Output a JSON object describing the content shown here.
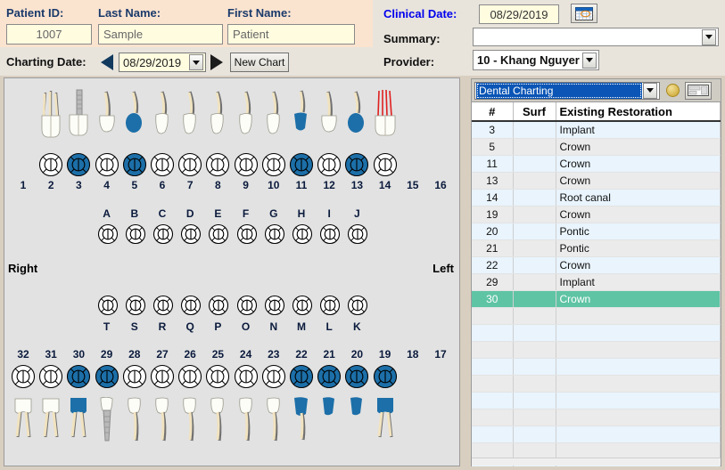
{
  "patient": {
    "id_label": "Patient ID:",
    "id_value": "1007",
    "last_label": "Last Name:",
    "last_value": "Sample",
    "first_label": "First Name:",
    "first_value": "Patient"
  },
  "charting": {
    "label": "Charting Date:",
    "date_value": "08/29/2019",
    "prev_icon": "left-triangle-icon",
    "next_icon": "right-triangle-icon",
    "new_chart_label": "New Chart"
  },
  "clinical": {
    "date_label": "Clinical Date:",
    "date_value": "08/29/2019",
    "calendar_icon": "calendar-icon",
    "summary_label": "Summary:",
    "summary_value": "",
    "provider_label": "Provider:",
    "provider_value": "10 - Khang Nguyer"
  },
  "grid": {
    "mode_value": "Dental Charting",
    "gold_icon": "gold-circle-icon",
    "window_icon": "window-layout-icon",
    "columns": [
      "#",
      "Surf",
      "Existing Restoration"
    ],
    "rows": [
      {
        "num": "3",
        "surf": "",
        "restoration": "Implant"
      },
      {
        "num": "5",
        "surf": "",
        "restoration": "Crown"
      },
      {
        "num": "11",
        "surf": "",
        "restoration": "Crown"
      },
      {
        "num": "13",
        "surf": "",
        "restoration": "Crown"
      },
      {
        "num": "14",
        "surf": "",
        "restoration": "Root canal"
      },
      {
        "num": "19",
        "surf": "",
        "restoration": "Crown"
      },
      {
        "num": "20",
        "surf": "",
        "restoration": "Pontic"
      },
      {
        "num": "21",
        "surf": "",
        "restoration": "Pontic"
      },
      {
        "num": "22",
        "surf": "",
        "restoration": "Crown"
      },
      {
        "num": "29",
        "surf": "",
        "restoration": "Implant"
      },
      {
        "num": "30",
        "surf": "",
        "restoration": "Crown",
        "selected": true
      }
    ],
    "empty_row_count": 10
  },
  "odontogram": {
    "right_label": "Right",
    "left_label": "Left",
    "upper_numbers": [
      "1",
      "2",
      "3",
      "4",
      "5",
      "6",
      "7",
      "8",
      "9",
      "10",
      "11",
      "12",
      "13",
      "14",
      "15",
      "16"
    ],
    "lower_numbers": [
      "32",
      "31",
      "30",
      "29",
      "28",
      "27",
      "26",
      "25",
      "24",
      "23",
      "22",
      "21",
      "20",
      "19",
      "18",
      "17"
    ],
    "upper_letters": [
      "A",
      "B",
      "C",
      "D",
      "E",
      "F",
      "G",
      "H",
      "I",
      "J"
    ],
    "lower_letters": [
      "T",
      "S",
      "R",
      "Q",
      "P",
      "O",
      "N",
      "M",
      "L",
      "K"
    ],
    "upper_marked": [
      "3",
      "5",
      "11",
      "13"
    ],
    "lower_marked": [
      "30",
      "29",
      "22",
      "21",
      "20",
      "19"
    ],
    "upper_present": [
      "2",
      "3",
      "4",
      "5",
      "6",
      "7",
      "8",
      "9",
      "10",
      "11",
      "12",
      "13",
      "14"
    ],
    "lower_present": [
      "32",
      "31",
      "30",
      "29",
      "28",
      "27",
      "26",
      "25",
      "24",
      "23",
      "22",
      "21",
      "20",
      "19"
    ],
    "root_canal_tooth": "14",
    "implant_teeth": [
      "3",
      "29"
    ],
    "pontic_teeth": [
      "20",
      "21"
    ],
    "restoration_color": "#1c6fa8",
    "root_canal_color": "#e02020"
  },
  "colors": {
    "header_band": "#fae3cf",
    "panel_bg": "#e2e2e2",
    "selected_row": "#5fc4a4",
    "combo_highlight": "#0a55b5",
    "clinical_label": "#0000ee",
    "label_navy": "#1a3a6b"
  }
}
